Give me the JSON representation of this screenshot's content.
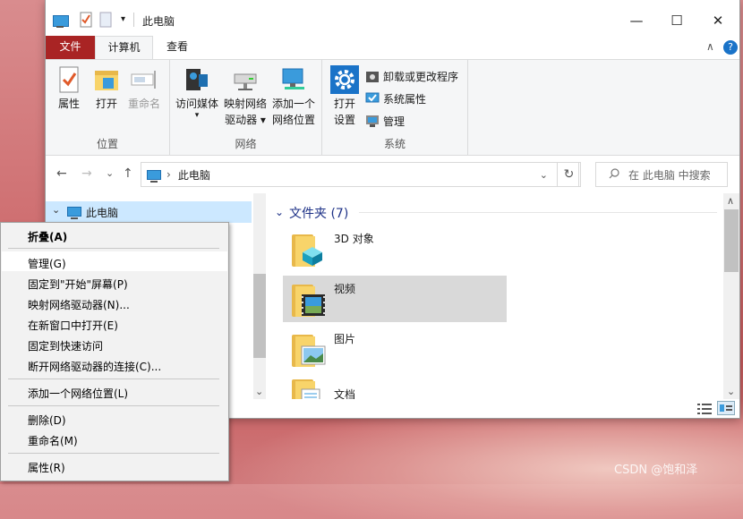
{
  "window": {
    "title": "此电脑",
    "controls": {
      "minimize": "—",
      "maximize": "☐",
      "close": "✕"
    }
  },
  "tabs": {
    "file": "文件",
    "computer": "计算机",
    "view": "查看",
    "collapse": "∧",
    "help": "?"
  },
  "ribbon": {
    "groups": {
      "location": {
        "label": "位置",
        "buttons": [
          "属性",
          "打开",
          "重命名"
        ]
      },
      "network": {
        "label": "网络",
        "access_media": [
          "访问媒体",
          "▾"
        ],
        "map_drive": [
          "映射网络",
          "驱动器 ▾"
        ],
        "add_location": [
          "添加一个",
          "网络位置"
        ]
      },
      "system": {
        "label": "系统",
        "open_settings": [
          "打开",
          "设置"
        ],
        "uninstall": "卸载或更改程序",
        "system_props": "系统属性",
        "manage": "管理"
      }
    }
  },
  "address": {
    "back": "←",
    "forward": "→",
    "recent": "⌄",
    "up": "↑",
    "sep": "›",
    "path": "此电脑",
    "dropdown": "⌄",
    "refresh": "↻",
    "search_placeholder": "在 此电脑 中搜索"
  },
  "nav": {
    "selected": "此电脑",
    "expander": "⌄",
    "scroll_down": "⌄"
  },
  "content": {
    "section": "文件夹 (7)",
    "section_chevron": "⌄",
    "folders": [
      "3D 对象",
      "视频",
      "图片",
      "文档"
    ],
    "scroll_up": "∧",
    "scroll_down": "⌄"
  },
  "context_menu": {
    "items": [
      {
        "label": "折叠(A)",
        "bold": true
      },
      {
        "label": "管理(G)"
      },
      {
        "label": "固定到\"开始\"屏幕(P)"
      },
      {
        "label": "映射网络驱动器(N)..."
      },
      {
        "label": "在新窗口中打开(E)"
      },
      {
        "label": "固定到快速访问"
      },
      {
        "label": "断开网络驱动器的连接(C)..."
      },
      {
        "label": "添加一个网络位置(L)"
      },
      {
        "label": "删除(D)"
      },
      {
        "label": "重命名(M)"
      },
      {
        "label": "属性(R)"
      }
    ]
  },
  "watermark": "CSDN @饱和泽",
  "colors": {
    "file_tab": "#a92424",
    "selection": "#cce8ff",
    "section_head": "#1e3287",
    "accent_blue": "#3a9bdc"
  }
}
